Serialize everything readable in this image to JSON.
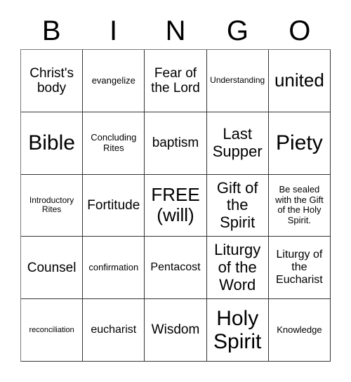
{
  "card": {
    "title_letters": [
      "B",
      "I",
      "N",
      "G",
      "O"
    ],
    "grid": {
      "columns": 5,
      "rows": 5,
      "cells": [
        {
          "text": "Christ's body",
          "size": "fs-l"
        },
        {
          "text": "evangelize",
          "size": "fs-sm"
        },
        {
          "text": "Fear of the Lord",
          "size": "fs-l"
        },
        {
          "text": "Understanding",
          "size": "fs-s"
        },
        {
          "text": "united",
          "size": "fs-xxl"
        },
        {
          "text": "Bible",
          "size": "fs-huge"
        },
        {
          "text": "Concluding Rites",
          "size": "fs-sm"
        },
        {
          "text": "baptism",
          "size": "fs-l"
        },
        {
          "text": "Last Supper",
          "size": "fs-xl"
        },
        {
          "text": "Piety",
          "size": "fs-huge"
        },
        {
          "text": "Introductory Rites",
          "size": "fs-s"
        },
        {
          "text": "Fortitude",
          "size": "fs-l"
        },
        {
          "text": "FREE (will)",
          "size": "fs-xxl"
        },
        {
          "text": "Gift of the Spirit",
          "size": "fs-xl"
        },
        {
          "text": "Be sealed with the Gift of the Holy Spirit.",
          "size": "fs-sm"
        },
        {
          "text": "Counsel",
          "size": "fs-l"
        },
        {
          "text": "confirmation",
          "size": "fs-sm"
        },
        {
          "text": "Pentacost",
          "size": "fs-m"
        },
        {
          "text": "Liturgy of the Word",
          "size": "fs-xl"
        },
        {
          "text": "Liturgy of the Eucharist",
          "size": "fs-m"
        },
        {
          "text": "reconciliation",
          "size": "fs-xs"
        },
        {
          "text": "eucharist",
          "size": "fs-m"
        },
        {
          "text": "Wisdom",
          "size": "fs-l"
        },
        {
          "text": "Holy Spirit",
          "size": "fs-huge"
        },
        {
          "text": "Knowledge",
          "size": "fs-sm"
        }
      ]
    },
    "colors": {
      "background": "#ffffff",
      "text": "#000000",
      "grid_line": "#333333"
    }
  }
}
